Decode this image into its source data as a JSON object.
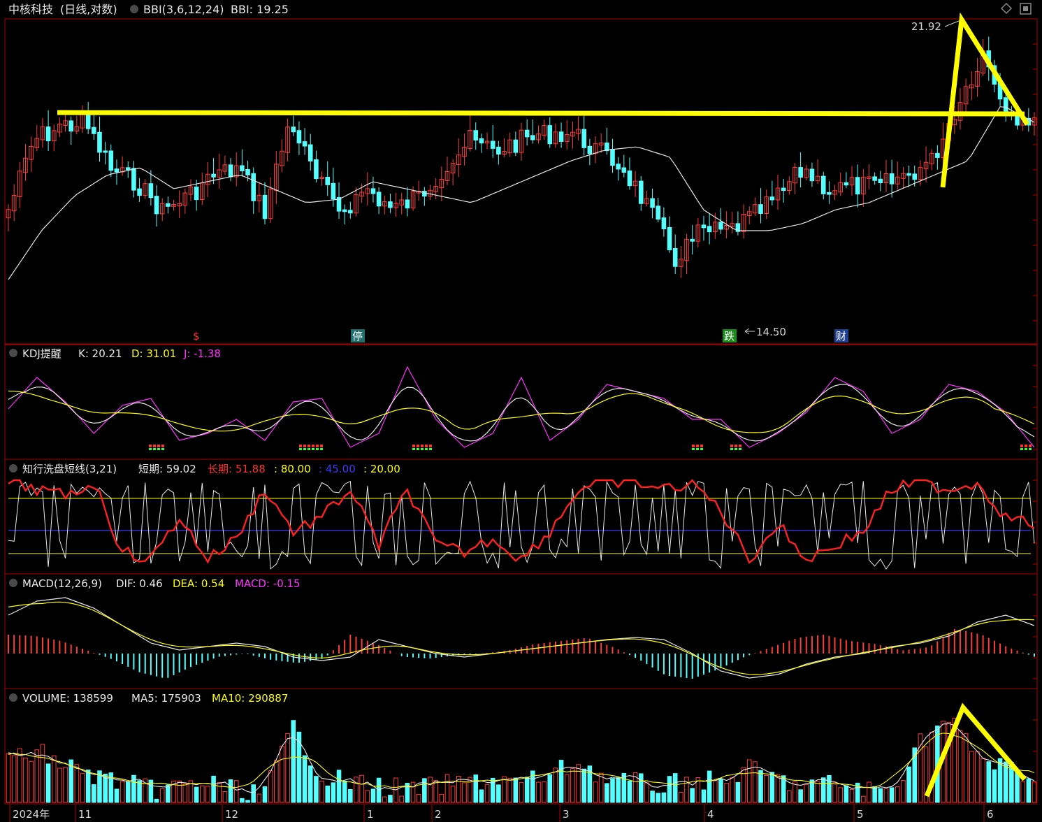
{
  "header": {
    "stock_name": "中核科技",
    "period": "(日线,对数)",
    "indicator_name": "BBI(3,6,12,24)",
    "indicator_value_label": "BBI: 19.25"
  },
  "price_annotations": {
    "high_label": "21.92",
    "low_label": "14.50",
    "marker_s": "$",
    "marker_stop": "停",
    "marker_fall": "跌",
    "marker_fin": "财"
  },
  "kdj": {
    "title": "KDJ提醒",
    "k_label": "K: 20.21",
    "d_label": "D: 31.01",
    "j_label": "J: -1.38"
  },
  "wash": {
    "title": "知行洗盘短线(3,21)",
    "short_label": "短期: 59.02",
    "long_label": "长期: 51.88",
    "lvl80_label": ": 80.00",
    "lvl45_label": ": 45.00",
    "lvl20_label": ": 20.00"
  },
  "macd": {
    "title": "MACD(12,26,9)",
    "dif_label": "DIF: 0.46",
    "dea_label": "DEA: 0.54",
    "macd_label": "MACD: -0.15"
  },
  "volume": {
    "title": "VOLUME: 138599",
    "ma5_label": "MA5: 175903",
    "ma10_label": "MA10: 290887"
  },
  "date_axis": {
    "labels": [
      "2024年",
      "11",
      "12",
      "1",
      "2",
      "3",
      "4",
      "5",
      "6"
    ]
  },
  "colors": {
    "up": "#ff3c3c",
    "down": "#54ffff",
    "panel_border": "#b00000",
    "yellow": "#ffff00",
    "magenta": "#ff30ff",
    "blue": "#3a3aff",
    "white": "#e8e8e8"
  },
  "chart_data": {
    "type": "candlestick",
    "y_scale": "log",
    "price_extremes": {
      "high": 21.92,
      "low": 14.5
    },
    "bbi_last": 19.25,
    "kdj_last": {
      "K": 20.21,
      "D": 31.01,
      "J": -1.38
    },
    "wash_last": {
      "short": 59.02,
      "long": 51.88
    },
    "wash_levels": [
      80.0,
      45.0,
      20.0
    ],
    "macd_last": {
      "DIF": 0.46,
      "DEA": 0.54,
      "MACD": -0.15
    },
    "volume_last": {
      "VOLUME": 138599,
      "MA5": 175903,
      "MA10": 290887
    }
  }
}
